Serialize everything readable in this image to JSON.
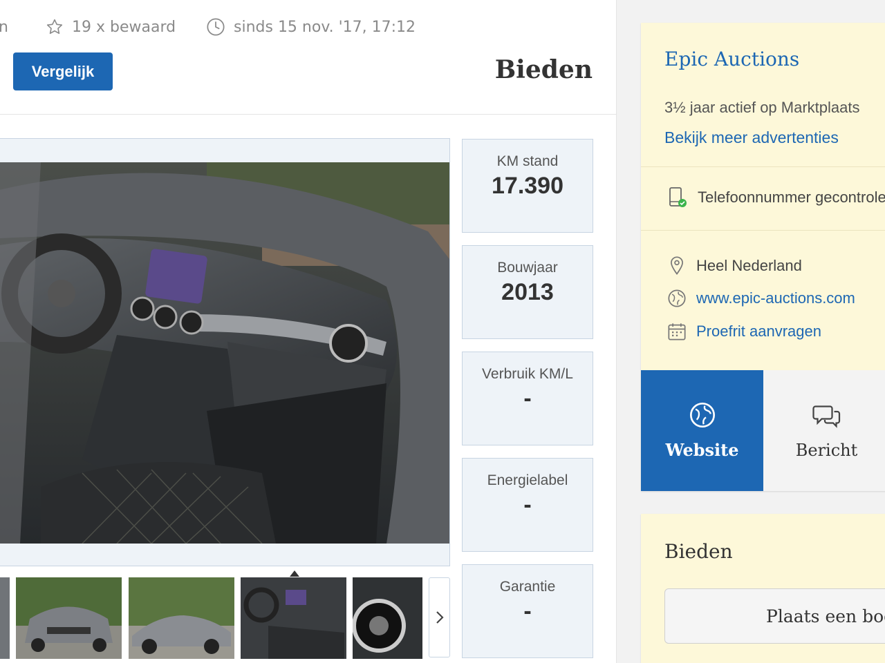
{
  "listing": {
    "meta": {
      "truncated_left": "n",
      "saved_count": "19 x bewaard",
      "since": "sinds 15 nov. '17, 17:12"
    },
    "compare_label": "Vergelijk",
    "bid_title": "Bieden"
  },
  "specs": [
    {
      "label": "KM stand",
      "value": "17.390"
    },
    {
      "label": "Bouwjaar",
      "value": "2013"
    },
    {
      "label": "Verbruik KM/L",
      "value": "-"
    },
    {
      "label": "Energielabel",
      "value": "-"
    },
    {
      "label": "Garantie",
      "value": "-"
    }
  ],
  "seller": {
    "name": "Epic Auctions",
    "active": "3½ jaar actief op Marktplaats",
    "more_ads": "Bekijk meer advertenties",
    "phone_verified": "Telefoonnummer gecontroleerd",
    "location": "Heel Nederland",
    "website_url": "www.epic-auctions.com",
    "test_drive": "Proefrit aanvragen",
    "website_button": "Website",
    "message_button": "Bericht"
  },
  "bidding": {
    "title": "Bieden",
    "place_bid": "Plaats een bod"
  },
  "colors": {
    "primary": "#1d67b3",
    "sidebar_bg": "#fdf8d9",
    "spec_bg": "#eef3f8",
    "verified_green": "#3cb44b"
  },
  "icons": {
    "saved": "star-icon",
    "since": "clock-icon",
    "phone": "phone-check-icon",
    "location": "location-pin-icon",
    "website": "globe-icon",
    "test_drive": "calendar-icon",
    "message": "chat-bubbles-icon",
    "next": "chevron-right-icon"
  }
}
